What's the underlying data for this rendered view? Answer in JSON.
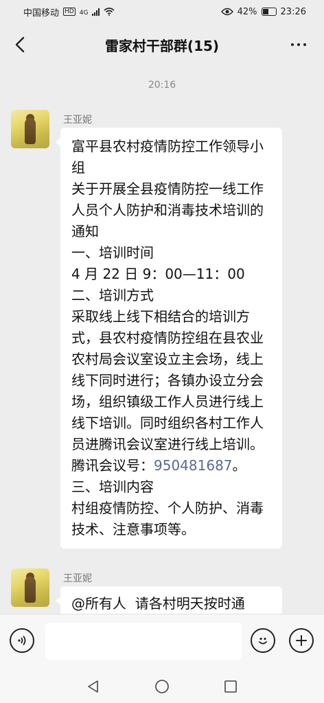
{
  "status": {
    "carrier": "中国移动",
    "hd_badge": "HD",
    "network": "4G",
    "battery": "42%",
    "time": "23:26"
  },
  "header": {
    "title": "雷家村干部群(15)"
  },
  "timestamp": "20:16",
  "messages": [
    {
      "sender": "王亚妮",
      "text_before": "富平县农村疫情防控工作领导小组\n关于开展全县疫情防控一线工作人员个人防护和消毒技术培训的通知\n一、培训时间\n4 月 22 日 9：00—11：00\n二、培训方式\n采取线上线下相结合的培训方式，县农村疫情防控组在县农业农村局会议室设立主会场，线上线下同时进行；各镇办设立分会场，组织镇级工作人员进行线上线下培训。同时组织各村工作人员进腾讯会议室进行线上培训。\n腾讯会议号：",
      "meeting_id": "950481687",
      "text_after": "。\n三、培训内容\n村组疫情防控、个人防护、消毒技术、注意事项等。"
    },
    {
      "sender": "王亚妮",
      "text": "@所有人  请各村明天按时通"
    }
  ],
  "icons": {
    "back": "back-arrow-icon",
    "more": "more-icon",
    "voice": "voice-icon",
    "emoji": "emoji-icon",
    "plus": "plus-icon"
  }
}
